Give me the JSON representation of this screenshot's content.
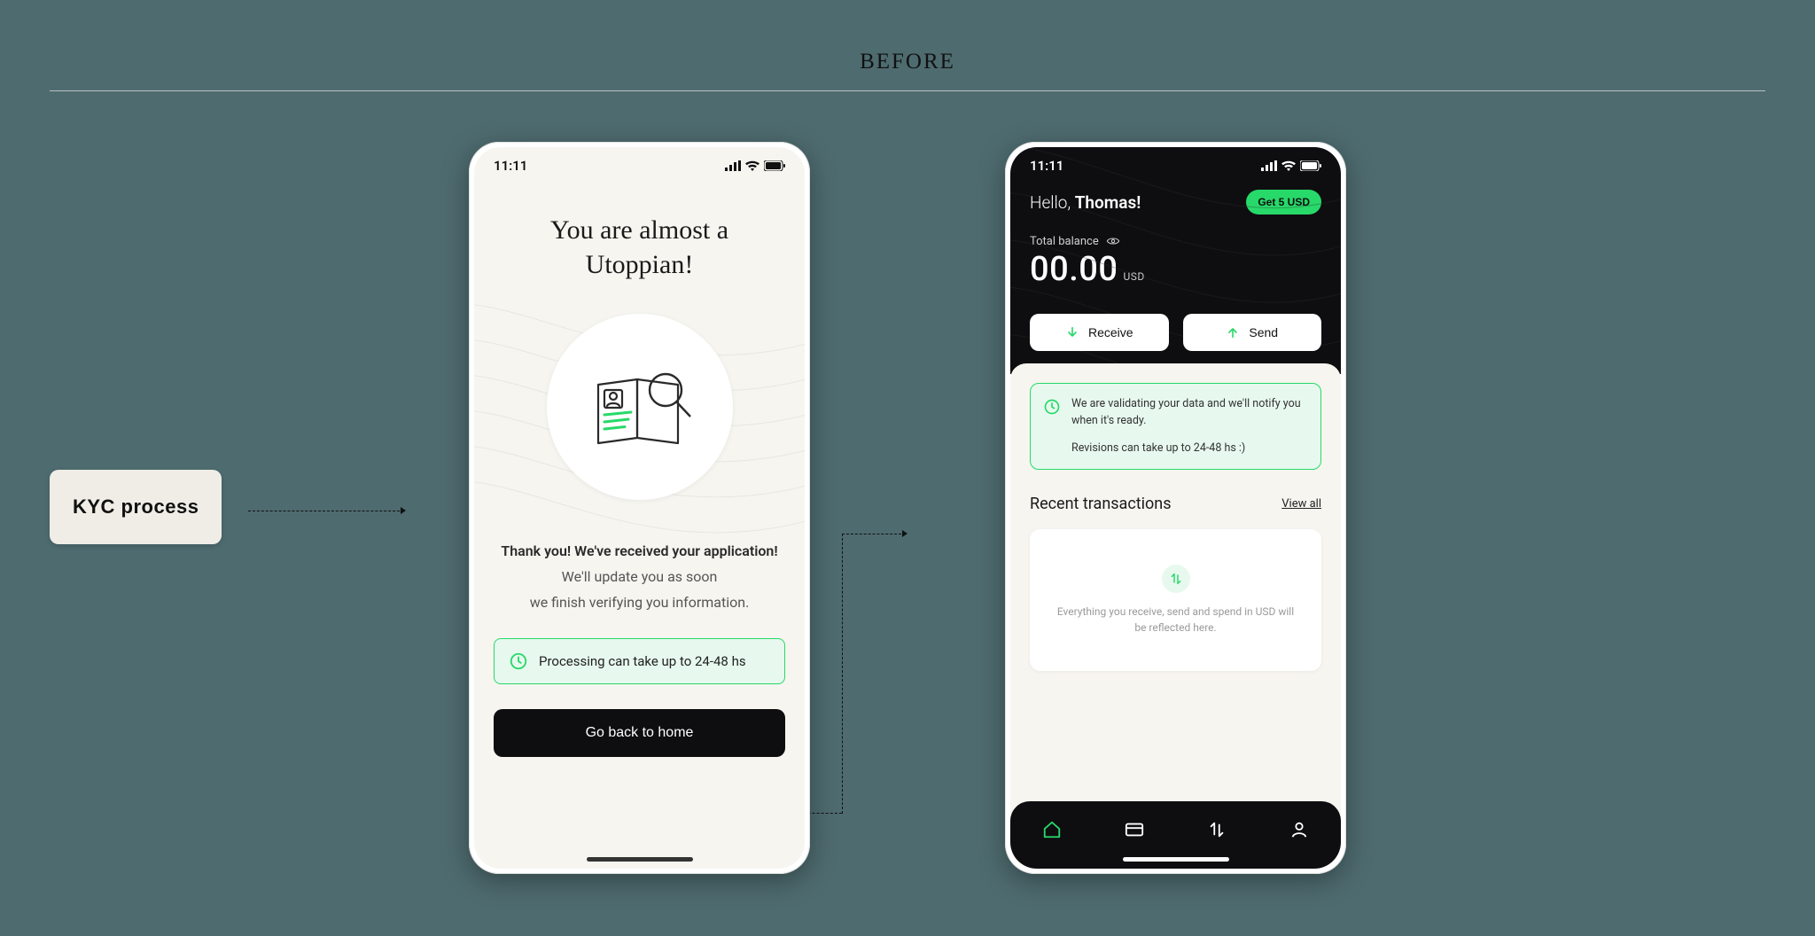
{
  "colors": {
    "accent": "#27d969",
    "bg": "#4e6b6f",
    "black": "#0e0e10"
  },
  "heading": "BEFORE",
  "label": "KYC process",
  "statusTime": "11:11",
  "phoneA": {
    "title": "You are almost a Utoppian!",
    "thanks_bold": "Thank you! We've received your application!",
    "thanks_line1": "We'll update you as soon",
    "thanks_line2": "we finish verifying you information.",
    "processing": "Processing can take up to 24-48 hs",
    "cta": "Go back to home"
  },
  "phoneB": {
    "hello_prefix": "Hello, ",
    "hello_name": "Thomas!",
    "promo": "Get 5 USD",
    "balance_label": "Total balance",
    "balance_value": "00.00",
    "balance_currency": "USD",
    "receive": "Receive",
    "send": "Send",
    "info_line1": "We are validating your data and we'll notify you when it's ready.",
    "info_line2": "Revisions can take up to 24-48 hs :)",
    "recent_title": "Recent transactions",
    "view_all": "View all",
    "empty_hint": "Everything you receive, send and spend in USD will be reflected here.",
    "tabs": [
      "home",
      "card",
      "transfer",
      "profile"
    ]
  }
}
